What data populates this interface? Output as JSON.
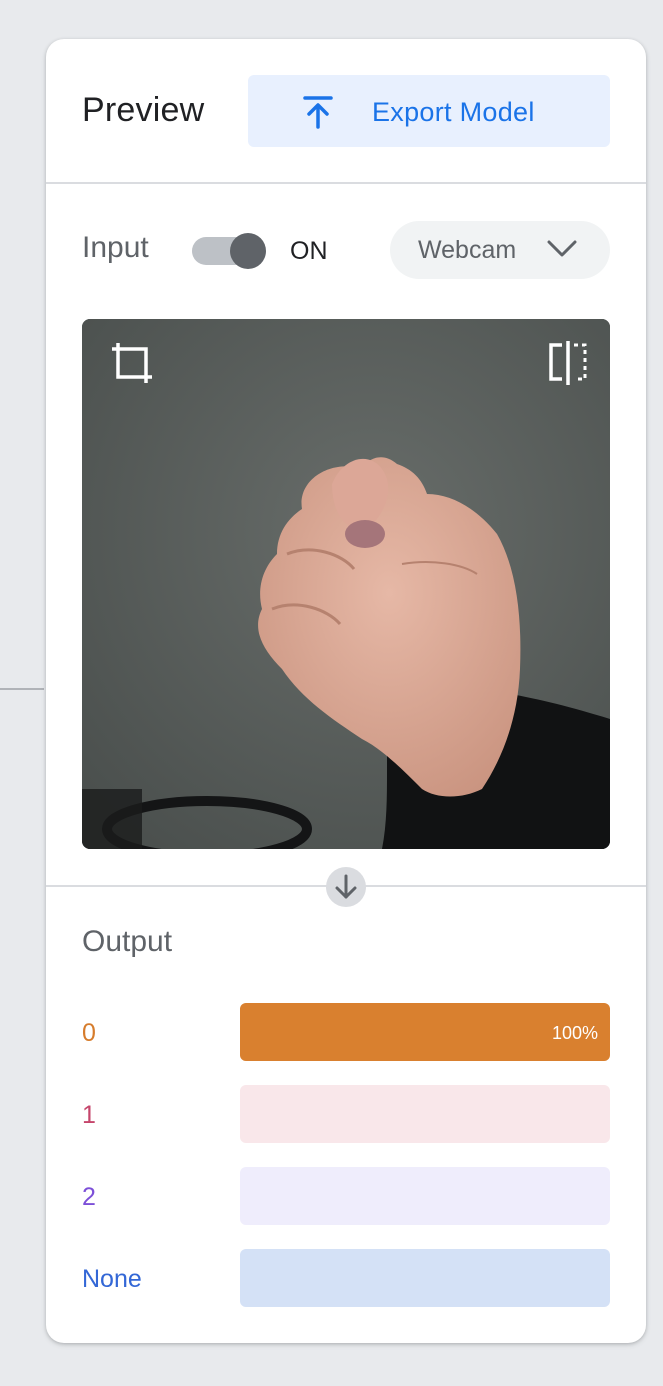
{
  "header": {
    "title": "Preview",
    "export_label": "Export Model",
    "export_icon": "upload-arrow-icon"
  },
  "input": {
    "label": "Input",
    "toggle_state": "ON",
    "toggle_on": true,
    "source": "Webcam"
  },
  "webcam": {
    "crop_icon": "crop-icon",
    "flip_icon": "flip-icon"
  },
  "output": {
    "title": "Output",
    "classes": [
      {
        "label": "0",
        "value": 1.0,
        "percent_text": "100%",
        "label_color": "#d67c2c",
        "bar_color": "#d9802f",
        "bar_bg": "#fbe9dc"
      },
      {
        "label": "1",
        "value": 0.0,
        "percent_text": "",
        "label_color": "#c5456b",
        "bar_color": "#d9467b",
        "bar_bg": "#f9e7ea"
      },
      {
        "label": "2",
        "value": 0.0,
        "percent_text": "",
        "label_color": "#7c4fd8",
        "bar_color": "#7c4fd8",
        "bar_bg": "#efedfc"
      },
      {
        "label": "None",
        "value": 0.0,
        "percent_text": "",
        "label_color": "#3367d6",
        "bar_color": "#3367d6",
        "bar_bg": "#d4e1f6"
      }
    ]
  }
}
